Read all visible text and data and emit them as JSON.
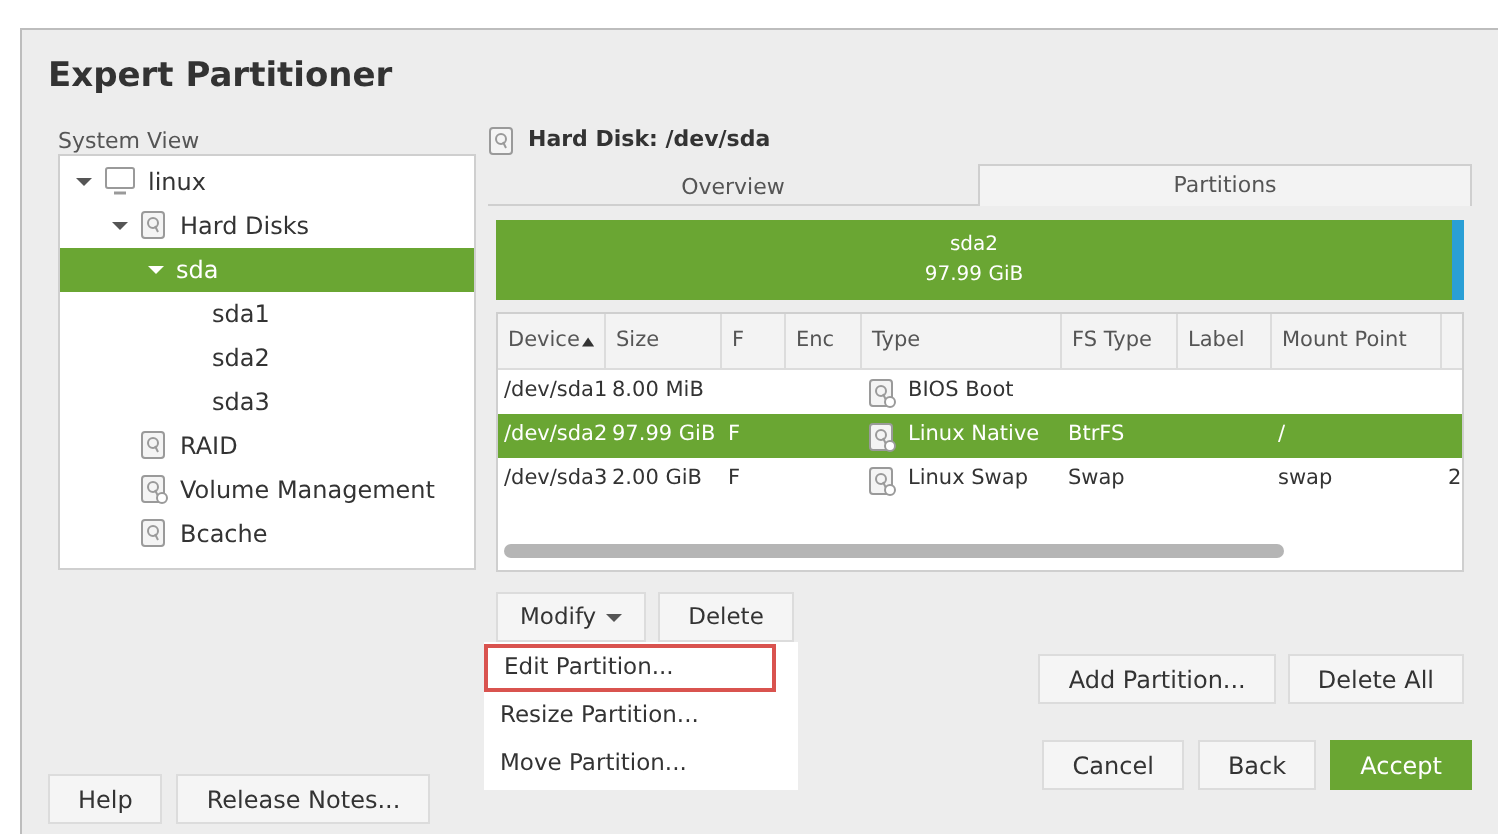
{
  "window": {
    "title": "Expert Partitioner"
  },
  "system_view": {
    "label": "System View",
    "tree": [
      {
        "label": "linux",
        "kind": "computer",
        "expanded": true,
        "selected": false,
        "children": [
          {
            "label": "Hard Disks",
            "kind": "disk",
            "expanded": true,
            "selected": false,
            "children": [
              {
                "label": "sda",
                "expanded": true,
                "selected": true,
                "children": [
                  {
                    "label": "sda1",
                    "selected": false
                  },
                  {
                    "label": "sda2",
                    "selected": false
                  },
                  {
                    "label": "sda3",
                    "selected": false
                  }
                ]
              }
            ]
          },
          {
            "label": "RAID",
            "kind": "disk",
            "selected": false
          },
          {
            "label": "Volume Management",
            "kind": "volume",
            "selected": false
          },
          {
            "label": "Bcache",
            "kind": "disk",
            "selected": false
          }
        ]
      }
    ]
  },
  "device_header": {
    "title": "Hard Disk: /dev/sda"
  },
  "tabs": [
    {
      "label": "Overview",
      "selected": false
    },
    {
      "label": "Partitions",
      "selected": true
    }
  ],
  "disk_bar": {
    "segments": [
      {
        "name": "sda2",
        "size": "97.99 GiB",
        "color": "#6aa633"
      },
      {
        "color": "#2a9fd6"
      }
    ]
  },
  "table": {
    "columns": [
      {
        "label": "Device",
        "sorted": true
      },
      {
        "label": "Size",
        "sorted": false
      },
      {
        "label": "F",
        "sorted": false
      },
      {
        "label": "Enc",
        "sorted": false
      },
      {
        "label": "Type",
        "sorted": false
      },
      {
        "label": "FS Type",
        "sorted": false
      },
      {
        "label": "Label",
        "sorted": false
      },
      {
        "label": "Mount Point",
        "sorted": false
      }
    ],
    "rows": [
      {
        "selected": false,
        "device": "/dev/sda1",
        "size": "8.00 MiB",
        "type": "BIOS Boot"
      },
      {
        "selected": true,
        "device": "/dev/sda2",
        "size": "97.99 GiB",
        "f": "F",
        "type": "Linux Native",
        "fs_type": "BtrFS",
        "mount_point": "/"
      },
      {
        "selected": false,
        "device": "/dev/sda3",
        "size": "2.00 GiB",
        "f": "F",
        "type": "Linux Swap",
        "fs_type": "Swap",
        "mount_point": "swap",
        "column_9": "2"
      }
    ]
  },
  "modify_button": {
    "label": "Modify"
  },
  "delete_button": {
    "label": "Delete"
  },
  "modify_menu": [
    {
      "label": "Edit Partition...",
      "marked": true
    },
    {
      "label": "Resize Partition...",
      "marked": false
    },
    {
      "label": "Move Partition...",
      "marked": false
    }
  ],
  "add_partition_button": {
    "label": "Add Partition..."
  },
  "delete_all_button": {
    "label": "Delete All"
  },
  "footer_buttons": [
    {
      "label": "Help",
      "primary": false
    },
    {
      "label": "Release Notes...",
      "primary": false
    },
    {
      "label": "Cancel",
      "primary": false
    },
    {
      "label": "Back",
      "primary": false
    },
    {
      "label": "Accept",
      "primary": true
    }
  ]
}
